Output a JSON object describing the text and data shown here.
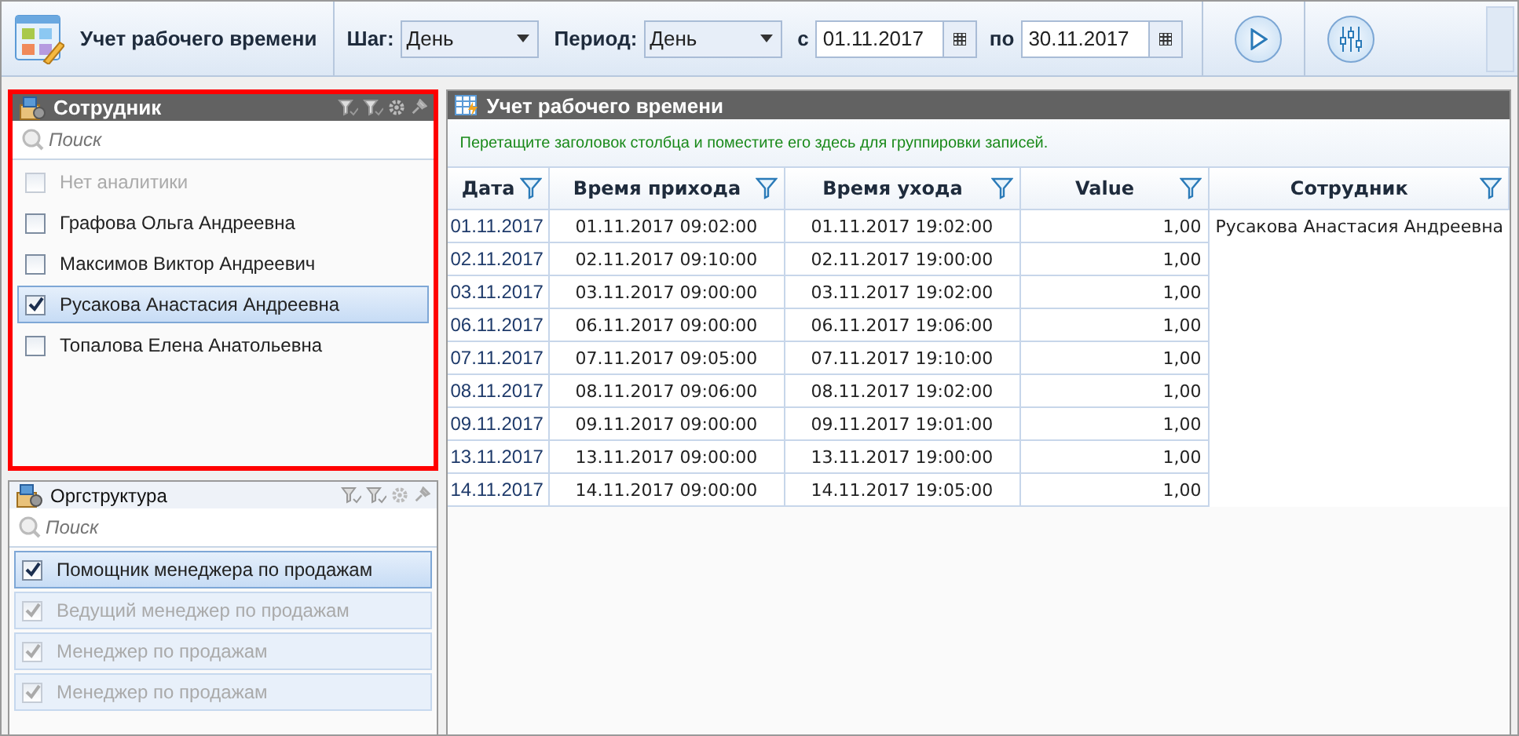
{
  "toolbar": {
    "title": "Учет рабочего времени",
    "step": {
      "label": "Шаг:",
      "value": "День"
    },
    "period": {
      "label": "Период:",
      "value": "День"
    },
    "from": {
      "label": "с",
      "value": "01.11.2017"
    },
    "to": {
      "label": "по",
      "value": "30.11.2017"
    }
  },
  "panels": [
    {
      "title": "Сотрудник",
      "highlighted": true,
      "active": true,
      "search": {
        "placeholder": "Поиск"
      },
      "items": [
        {
          "label": "Нет аналитики",
          "checked": false,
          "disabled": true,
          "selected": false
        },
        {
          "label": "Графова Ольга Андреевна",
          "checked": false,
          "disabled": false,
          "selected": false
        },
        {
          "label": "Максимов Виктор Андреевич",
          "checked": false,
          "disabled": false,
          "selected": false
        },
        {
          "label": "Русакова Анастасия Андреевна",
          "checked": true,
          "disabled": false,
          "selected": true
        },
        {
          "label": "Топалова Елена Анатольевна",
          "checked": false,
          "disabled": false,
          "selected": false
        }
      ]
    },
    {
      "title": "Оргструктура",
      "highlighted": false,
      "active": false,
      "search": {
        "placeholder": "Поиск"
      },
      "items": [
        {
          "label": "Помощник менеджера по продажам",
          "checked": true,
          "disabled": false,
          "selected": true
        },
        {
          "label": "Ведущий менеджер по продажам",
          "checked": true,
          "disabled": true,
          "selected": false
        },
        {
          "label": "Менеджер по продажам",
          "checked": true,
          "disabled": true,
          "selected": false
        },
        {
          "label": "Менеджер по продажам",
          "checked": true,
          "disabled": true,
          "selected": false
        }
      ]
    }
  ],
  "grid": {
    "title": "Учет рабочего времени",
    "group_hint": "Перетащите заголовок столбца и поместите его здесь для группировки записей.",
    "columns": [
      "Дата",
      "Время прихода",
      "Время ухода",
      "Value",
      "Сотрудник"
    ],
    "rows": [
      {
        "date": "01.11.2017",
        "arrival": "01.11.2017 09:02:00",
        "departure": "01.11.2017 19:02:00",
        "value": "1,00",
        "employee": "Русакова Анастасия Андреевна"
      },
      {
        "date": "02.11.2017",
        "arrival": "02.11.2017 09:10:00",
        "departure": "02.11.2017 19:00:00",
        "value": "1,00"
      },
      {
        "date": "03.11.2017",
        "arrival": "03.11.2017 09:00:00",
        "departure": "03.11.2017 19:02:00",
        "value": "1,00"
      },
      {
        "date": "06.11.2017",
        "arrival": "06.11.2017 09:00:00",
        "departure": "06.11.2017 19:06:00",
        "value": "1,00"
      },
      {
        "date": "07.11.2017",
        "arrival": "07.11.2017 09:05:00",
        "departure": "07.11.2017 19:10:00",
        "value": "1,00"
      },
      {
        "date": "08.11.2017",
        "arrival": "08.11.2017 09:06:00",
        "departure": "08.11.2017 19:02:00",
        "value": "1,00"
      },
      {
        "date": "09.11.2017",
        "arrival": "09.11.2017 09:00:00",
        "departure": "09.11.2017 19:01:00",
        "value": "1,00"
      },
      {
        "date": "13.11.2017",
        "arrival": "13.11.2017 09:00:00",
        "departure": "13.11.2017 19:00:00",
        "value": "1,00"
      },
      {
        "date": "14.11.2017",
        "arrival": "14.11.2017 09:00:00",
        "departure": "14.11.2017 19:05:00",
        "value": "1,00"
      }
    ]
  }
}
